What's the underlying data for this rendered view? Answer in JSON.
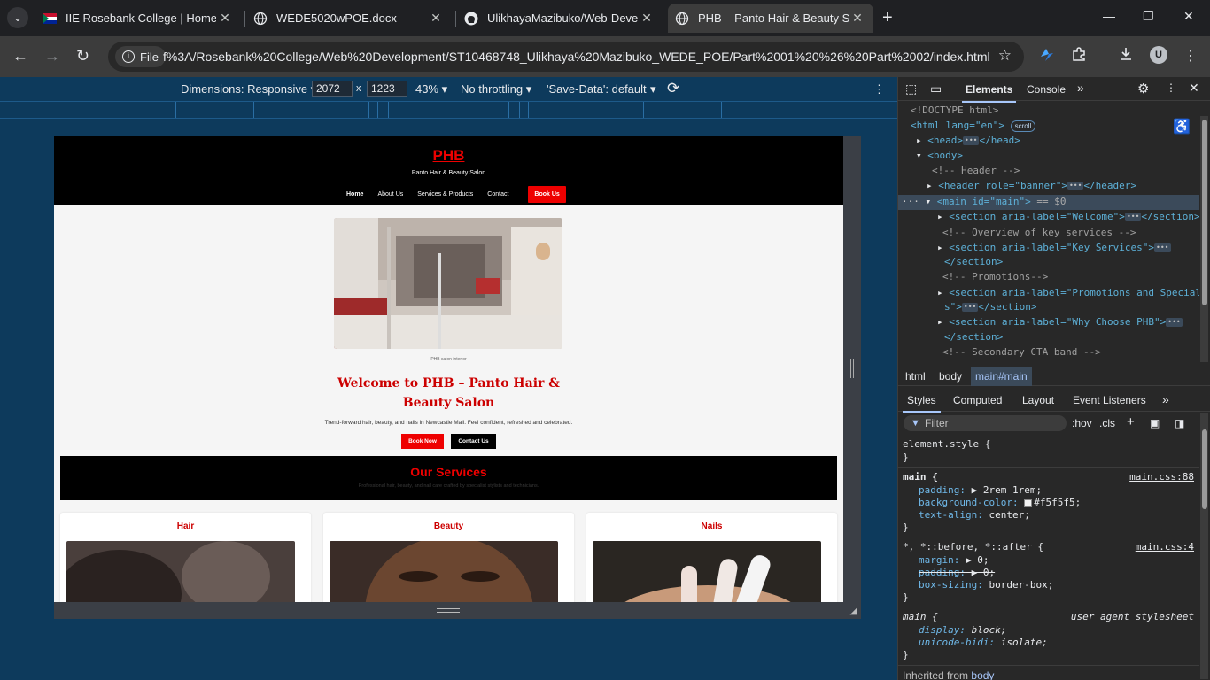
{
  "tabs": [
    {
      "title": "IIE Rosebank College | Home - I",
      "close": "✕"
    },
    {
      "title": "WEDE5020wPOE.docx",
      "close": "✕"
    },
    {
      "title": "UlikhayaMazibuko/Web-Develo",
      "close": "✕"
    },
    {
      "title": "PHB – Panto Hair & Beauty Salo",
      "close": "✕"
    }
  ],
  "new_tab": "+",
  "toolbar": {
    "file_label": "File",
    "url": "f%3A/Rosebank%20College/Web%20Development/ST10468748_Ulikhaya%20Mazibuko_WEDE_POE/Part%2001%20%26%20Part%2002/index.html",
    "avatar_letter": "U"
  },
  "device_toolbar": {
    "dimensions_label": "Dimensions: Responsive",
    "width": "2072",
    "height": "1223",
    "times": "x",
    "zoom": "43%",
    "throttling": "No throttling",
    "save_data": "'Save-Data': default"
  },
  "site": {
    "logo": "PHB",
    "tagline": "Panto Hair & Beauty Salon",
    "nav": [
      "Home",
      "About Us",
      "Services & Products",
      "Contact"
    ],
    "nav_cta": "Book Us",
    "hero_caption": "PHB salon interior",
    "welcome_title": "Welcome to PHB – Panto Hair & Beauty Salon",
    "lead": "Trend-forward hair, beauty, and nails in Newcastle Mall. Feel confident, refreshed and celebrated.",
    "cta_primary": "Book Now",
    "cta_secondary": "Contact Us",
    "services_title": "Our Services",
    "services_sub": "Professional hair, beauty, and nail care crafted by specialist stylists and technicians.",
    "cards": [
      "Hair",
      "Beauty",
      "Nails"
    ]
  },
  "devtools": {
    "tabs": [
      "Elements",
      "Console"
    ],
    "dom": {
      "doctype": "<!DOCTYPE html>",
      "html_open": "<html lang=\"en\">",
      "scroll_badge": "scroll",
      "head": "<head>",
      "head_close": "</head>",
      "body_open": "<body>",
      "cmt_header": "<!-- Header -->",
      "header_tag": "<header role=\"banner\">",
      "header_close": "</header>",
      "main_open": "<main id=\"main\">",
      "main_eq": "== $0",
      "welcome_section": "<section aria-label=\"Welcome\">",
      "section_close": "</section>",
      "cmt_overview": "<!-- Overview of key services -->",
      "key_section": "<section aria-label=\"Key Services\">",
      "cmt_promos": "<!-- Promotions-->",
      "promos_section_a": "<section aria-label=\"Promotions and Special",
      "promos_section_b": "s\">",
      "why_section": "<section aria-label=\"Why Choose PHB\">",
      "cmt_cta": "<!-- Secondary CTA band -->",
      "ellipsis": "•••"
    },
    "breadcrumbs": [
      "html",
      "body",
      "main#main"
    ],
    "subtabs": [
      "Styles",
      "Computed",
      "Layout",
      "Event Listeners"
    ],
    "filter_placeholder": "Filter",
    "filter_tools": [
      ":hov",
      ".cls"
    ],
    "styles": {
      "element_style": "element.style {",
      "close_brace": "}",
      "main_selector": "main {",
      "main_src": "main.css:88",
      "padding_prop": "padding:",
      "padding_val": "▶ 2rem 1rem;",
      "bg_prop": "background-color:",
      "bg_val": "#f5f5f5;",
      "ta_prop": "text-align:",
      "ta_val": "center;",
      "universal_selector": "*, *::before, *::after {",
      "universal_src": "main.css:4",
      "margin_prop": "margin:",
      "margin_val": "▶ 0;",
      "padding2_prop": "padding:",
      "padding2_val": "▶ 0;",
      "bs_prop": "box-sizing:",
      "bs_val": "border-box;",
      "ua_selector": "main {",
      "ua_label": "user agent stylesheet",
      "display_prop": "display:",
      "display_val": "block;",
      "ub_prop": "unicode-bidi:",
      "ub_val": "isolate;",
      "inherited": "Inherited from",
      "inherited_link": "body"
    }
  }
}
